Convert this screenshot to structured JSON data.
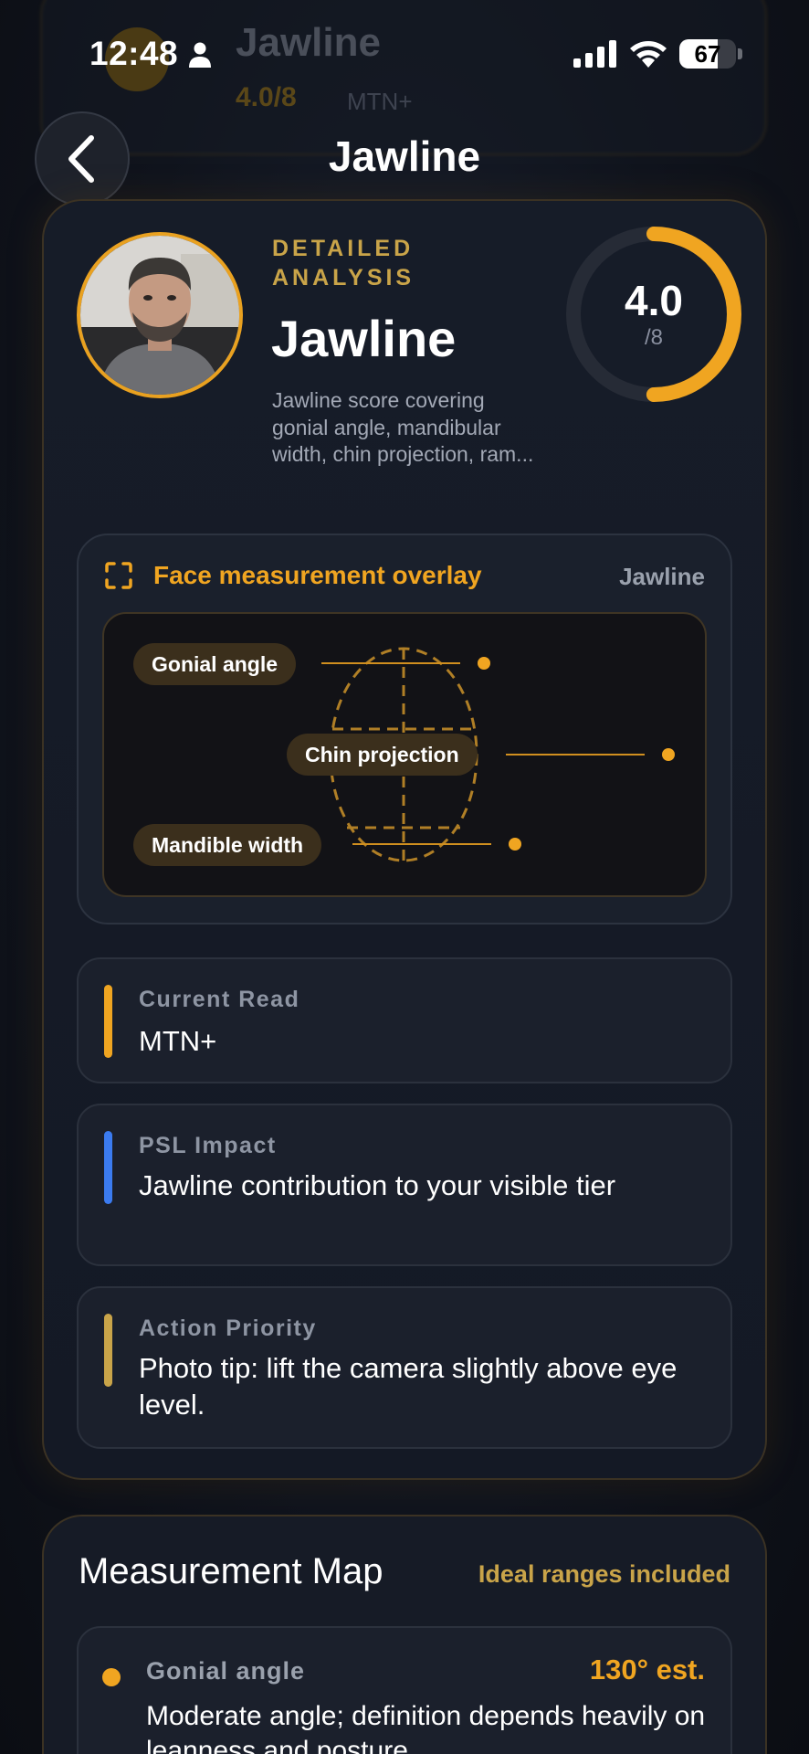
{
  "status_bar": {
    "time": "12:48",
    "battery": "67",
    "battery_level": 0.67
  },
  "ghost_header": {
    "title": "Jawline",
    "score": "4.0/8",
    "tier": "MTN+"
  },
  "nav": {
    "title": "Jawline"
  },
  "hero": {
    "eyebrow": "DETAILED ANALYSIS",
    "title": "Jawline",
    "description": "Jawline score covering gonial angle, mandibular width, chin projection, ram...",
    "score": "4.0",
    "score_max": "/8",
    "score_fraction": 0.5,
    "accent_color": "#f0a521"
  },
  "overlay": {
    "title": "Face measurement overlay",
    "tag": "Jawline",
    "labels": [
      "Gonial angle",
      "Chin projection",
      "Mandible width"
    ]
  },
  "cards": [
    {
      "label": "Current Read",
      "text": "MTN+",
      "bar_color": "#f0a521"
    },
    {
      "label": "PSL Impact",
      "text": "Jawline contribution to your visible tier",
      "bar_color": "#3b7bf0"
    },
    {
      "label": "Action Priority",
      "text": "Photo tip: lift the camera slightly above eye level.",
      "bar_color": "#c9a449"
    }
  ],
  "measurement_map": {
    "title": "Measurement Map",
    "note": "Ideal ranges included",
    "items": [
      {
        "label": "Gonial angle",
        "value": "130° est.",
        "description": "Moderate angle; definition depends heavily on leanness and posture."
      }
    ]
  }
}
